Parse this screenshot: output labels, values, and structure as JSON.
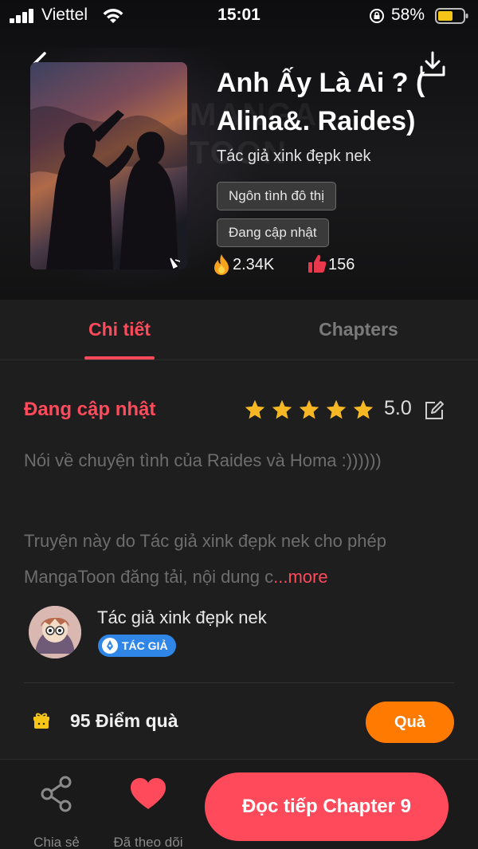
{
  "status_bar": {
    "carrier": "Viettel",
    "time": "15:01",
    "battery": "58%"
  },
  "cover": {
    "watermark": "MANGA TOON"
  },
  "book": {
    "title": "Anh Ấy Là Ai ? ( Alina&. Raides)",
    "author": "Tác giả xink đẹpk nek",
    "tags": [
      "Ngôn tình đô thị",
      "Đang cập nhật"
    ],
    "views": "2.34K",
    "likes": "156"
  },
  "tabs": {
    "detail": "Chi tiết",
    "chapters": "Chapters",
    "active": "detail"
  },
  "detail": {
    "status": "Đang cập nhật",
    "rating": "5.0",
    "stars": 5,
    "description": "Nói về chuyện tình của Raides và Homa :))))))",
    "license_text": "Truyện này do Tác giả xink đẹpk nek cho phép MangaToon đăng tải, nội dung c",
    "more_label": "...more",
    "author_name": "Tác giả xink đẹpk nek",
    "author_badge": "TÁC GIẢ",
    "gift_points": "95 Điểm quà",
    "gift_button": "Quà"
  },
  "bottom_bar": {
    "share_label": "Chia sẻ",
    "follow_label": "Đã theo dõi",
    "read_button": "Đọc tiếp Chapter 9"
  },
  "colors": {
    "accent": "#ff4a5b",
    "gift": "#ff7a00",
    "star": "#f5b824",
    "badge": "#2f86e6"
  },
  "icons": [
    "back-arrow-icon",
    "download-icon",
    "fire-icon",
    "thumbs-up-icon",
    "star-icon",
    "edit-icon",
    "gift-icon",
    "share-icon",
    "heart-icon",
    "wifi-icon",
    "lock-rotation-icon",
    "battery-icon",
    "signal-icon"
  ]
}
